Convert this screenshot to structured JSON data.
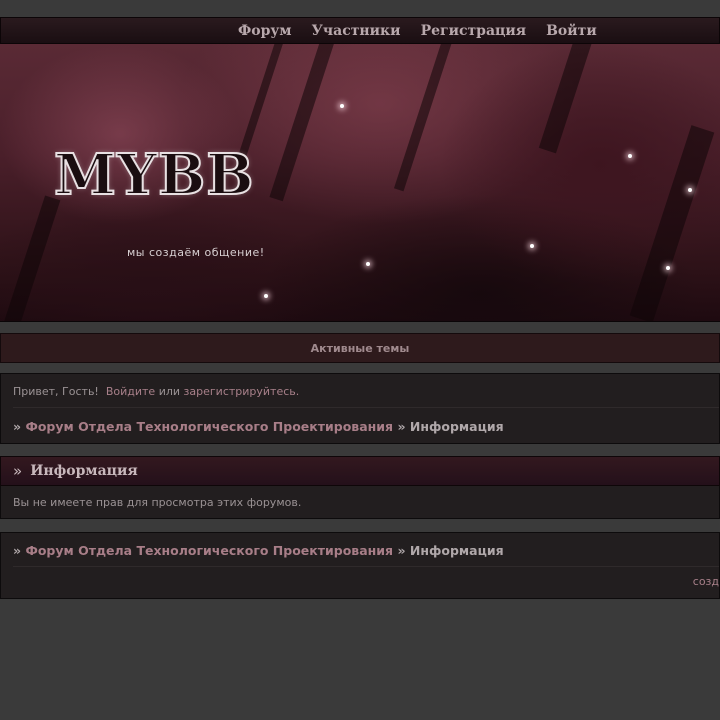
{
  "nav": {
    "items": [
      "Форум",
      "Участники",
      "Регистрация",
      "Войти"
    ]
  },
  "banner": {
    "logo": "MYBB",
    "slogan": "мы создаём общение!"
  },
  "active_topics": "Активные темы",
  "welcome": {
    "greeting": "Привет, Гость!",
    "login_link": "Войдите",
    "or": "или",
    "register_link": "зарегистрируйтесь."
  },
  "breadcrumb": {
    "sep": "»",
    "forum": "Форум Отдела Технологического Проектирования",
    "current": "Информация"
  },
  "info": {
    "title": "Информация",
    "message": "Вы не имеете прав для просмотра этих форумов."
  },
  "footer": {
    "credit": "созд"
  }
}
